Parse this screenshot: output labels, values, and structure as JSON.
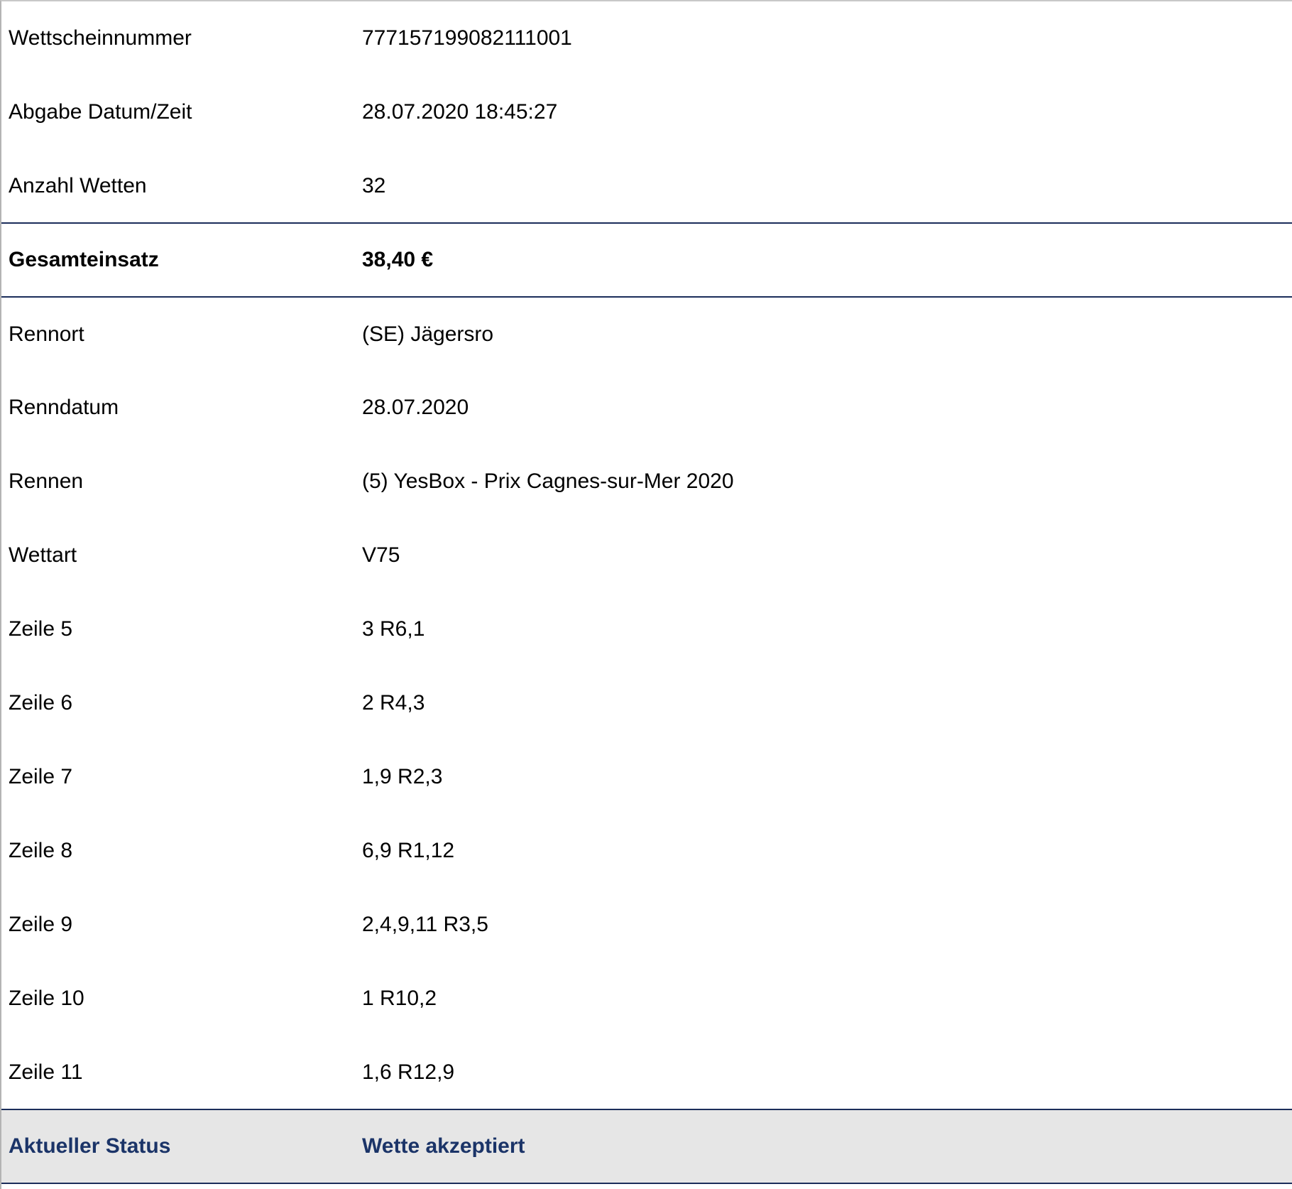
{
  "ticket": {
    "header_rows": [
      {
        "label": "Wettscheinnummer",
        "value": "777157199082111001"
      },
      {
        "label": "Abgabe Datum/Zeit",
        "value": "28.07.2020 18:45:27"
      },
      {
        "label": "Anzahl Wetten",
        "value": "32"
      }
    ],
    "total": {
      "label": "Gesamteinsatz",
      "value": "38,40 €"
    },
    "race_rows": [
      {
        "label": "Rennort",
        "value": "(SE) Jägersro"
      },
      {
        "label": "Renndatum",
        "value": "28.07.2020"
      },
      {
        "label": "Rennen",
        "value": "(5) YesBox - Prix Cagnes-sur-Mer 2020"
      },
      {
        "label": "Wettart",
        "value": "V75"
      },
      {
        "label": "Zeile 5",
        "value": "3 R6,1"
      },
      {
        "label": "Zeile 6",
        "value": "2 R4,3"
      },
      {
        "label": "Zeile 7",
        "value": "1,9 R2,3"
      },
      {
        "label": "Zeile 8",
        "value": "6,9 R1,12"
      },
      {
        "label": "Zeile 9",
        "value": "2,4,9,11 R3,5"
      },
      {
        "label": "Zeile 10",
        "value": "1 R10,2"
      },
      {
        "label": "Zeile 11",
        "value": "1,6 R12,9"
      }
    ],
    "status": {
      "label": "Aktueller Status",
      "value": "Wette akzeptiert"
    }
  },
  "colors": {
    "divider": "#1b2d5a",
    "status_text": "#1b3468",
    "status_background": "#e6e6e6"
  }
}
